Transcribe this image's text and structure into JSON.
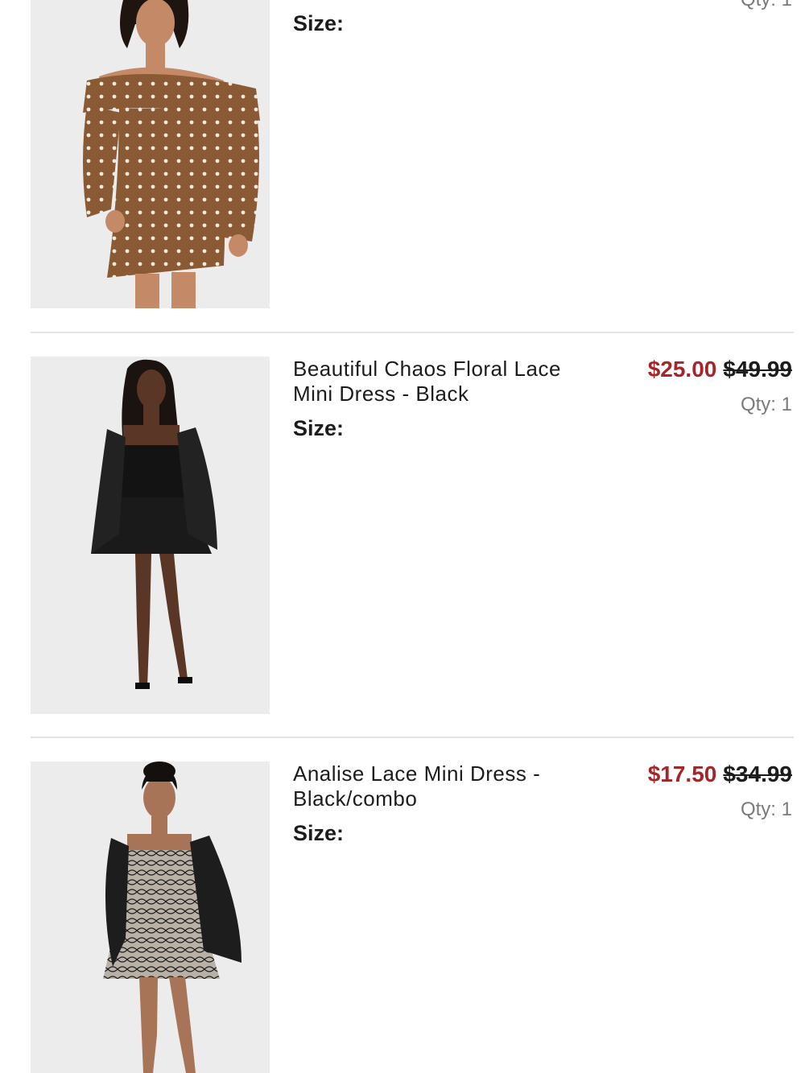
{
  "items": [
    {
      "size_label": "Size:",
      "qty": "Qty: 1"
    },
    {
      "name": "Beautiful Chaos Floral Lace Mini Dress - Black",
      "sale_price": "$25.00",
      "original_price": "$49.99",
      "qty": "Qty: 1",
      "size_label": "Size:"
    },
    {
      "name": "Analise Lace Mini Dress - Black/combo",
      "sale_price": "$17.50",
      "original_price": "$34.99",
      "qty": "Qty: 1",
      "size_label": "Size:"
    }
  ],
  "colors": {
    "sale_price": "#a3262b",
    "qty_text": "#7a7a7a",
    "divider": "#e3e3e3",
    "image_background": "#ececec"
  },
  "icons": [
    "product-photo-brown-polka-dot-dress",
    "product-photo-black-lace-dress",
    "product-photo-black-combo-lace-dress"
  ]
}
